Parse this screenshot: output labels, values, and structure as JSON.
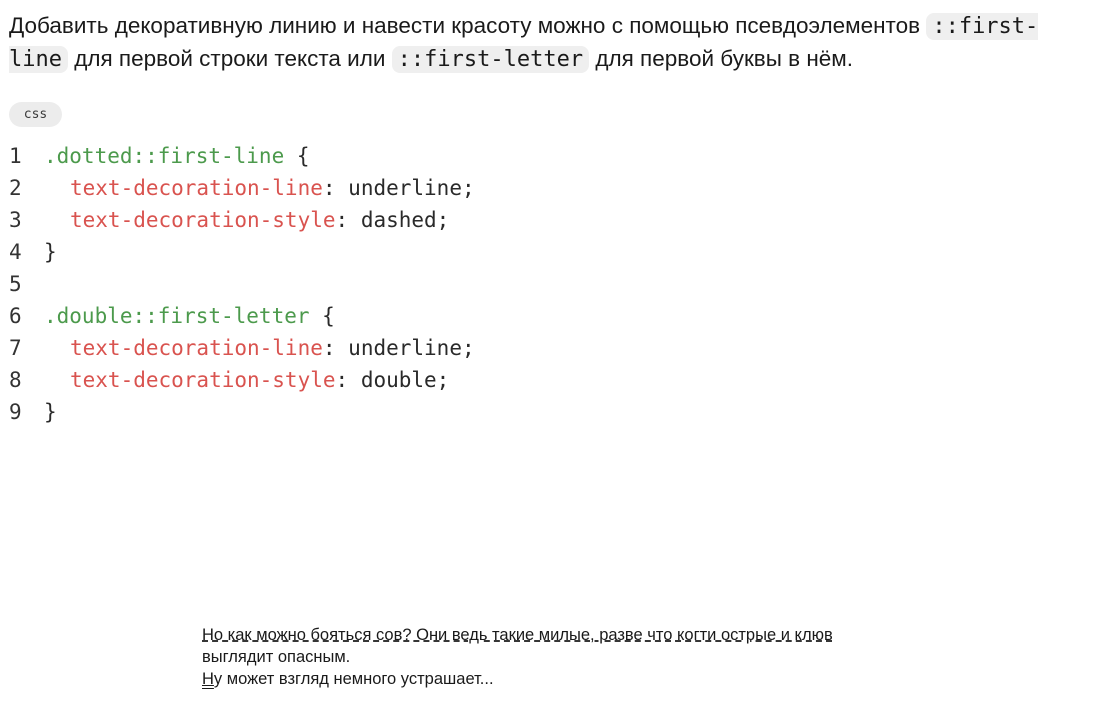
{
  "intro": {
    "before": "Добавить декоративную линию и навести красоту можно с помощью псевдоэлементов ",
    "code1": "::first-line",
    "middle": " для первой строки текста или ",
    "code2": "::first-letter",
    "after": " для первой буквы в нём."
  },
  "code_block": {
    "language": "css",
    "lines": [
      {
        "n": "1",
        "selector": ".dotted::first-line",
        "brace": " {"
      },
      {
        "n": "2",
        "property": "text-decoration-line",
        "value": "underline"
      },
      {
        "n": "3",
        "property": "text-decoration-style",
        "value": "dashed"
      },
      {
        "n": "4",
        "brace": "}"
      },
      {
        "n": "5"
      },
      {
        "n": "6",
        "selector": ".double::first-letter",
        "brace": " {"
      },
      {
        "n": "7",
        "property": "text-decoration-line",
        "value": "underline"
      },
      {
        "n": "8",
        "property": "text-decoration-style",
        "value": "double"
      },
      {
        "n": "9",
        "brace": "}"
      }
    ]
  },
  "demo": {
    "paragraph1": "Но как можно бояться сов? Они ведь такие милые, разве что когти острые и клюв выглядит опасным.",
    "paragraph2": "Ну может взгляд немного устрашает..."
  }
}
